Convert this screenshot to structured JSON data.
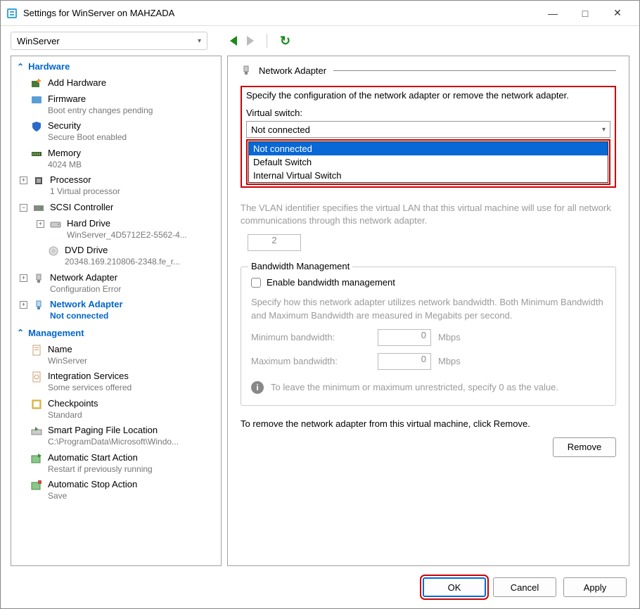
{
  "title": "Settings for WinServer on MAHZADA",
  "vm_name": "WinServer",
  "sidebar": {
    "hardware_label": "Hardware",
    "management_label": "Management",
    "items": {
      "add_hardware": {
        "label": "Add Hardware"
      },
      "firmware": {
        "label": "Firmware",
        "sub": "Boot entry changes pending"
      },
      "security": {
        "label": "Security",
        "sub": "Secure Boot enabled"
      },
      "memory": {
        "label": "Memory",
        "sub": "4024 MB"
      },
      "processor": {
        "label": "Processor",
        "sub": "1 Virtual processor"
      },
      "scsi": {
        "label": "SCSI Controller"
      },
      "hard_drive": {
        "label": "Hard Drive",
        "sub": "WinServer_4D5712E2-5562-4..."
      },
      "dvd_drive": {
        "label": "DVD Drive",
        "sub": "20348.169.210806-2348.fe_r..."
      },
      "net1": {
        "label": "Network Adapter",
        "sub": "Configuration Error"
      },
      "net2": {
        "label": "Network Adapter",
        "sub": "Not connected"
      },
      "name": {
        "label": "Name",
        "sub": "WinServer"
      },
      "integration": {
        "label": "Integration Services",
        "sub": "Some services offered"
      },
      "checkpoints": {
        "label": "Checkpoints",
        "sub": "Standard"
      },
      "paging": {
        "label": "Smart Paging File Location",
        "sub": "C:\\ProgramData\\Microsoft\\Windo..."
      },
      "autostart": {
        "label": "Automatic Start Action",
        "sub": "Restart if previously running"
      },
      "autostop": {
        "label": "Automatic Stop Action",
        "sub": "Save"
      }
    }
  },
  "panel": {
    "title": "Network Adapter",
    "desc": "Specify the configuration of the network adapter or remove the network adapter.",
    "vswitch_label": "Virtual switch:",
    "vswitch_value": "Not connected",
    "vswitch_options": [
      "Not connected",
      "Default Switch",
      "Internal Virtual Switch"
    ],
    "vlan_desc": "The VLAN identifier specifies the virtual LAN that this virtual machine will use for all network communications through this network adapter.",
    "vlan_value": "2",
    "bw_title": "Bandwidth Management",
    "bw_enable": "Enable bandwidth management",
    "bw_desc": "Specify how this network adapter utilizes network bandwidth. Both Minimum Bandwidth and Maximum Bandwidth are measured in Megabits per second.",
    "bw_min_label": "Minimum bandwidth:",
    "bw_max_label": "Maximum bandwidth:",
    "bw_min_value": "0",
    "bw_max_value": "0",
    "bw_unit": "Mbps",
    "bw_info": "To leave the minimum or maximum unrestricted, specify 0 as the value.",
    "remove_desc": "To remove the network adapter from this virtual machine, click Remove.",
    "remove_btn": "Remove"
  },
  "buttons": {
    "ok": "OK",
    "cancel": "Cancel",
    "apply": "Apply"
  }
}
